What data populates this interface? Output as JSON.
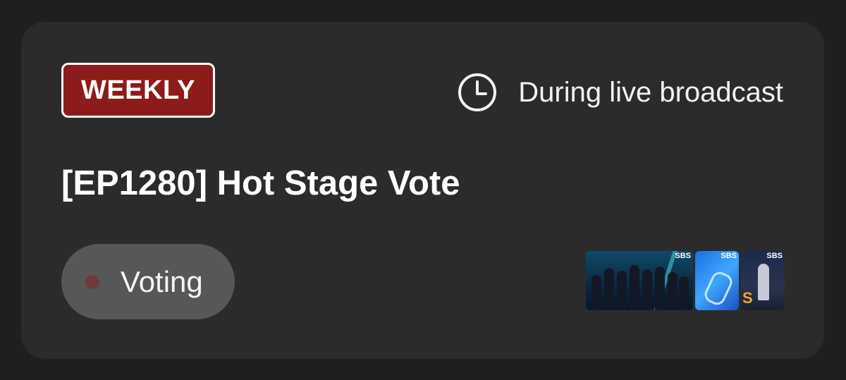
{
  "card": {
    "badge": "WEEKLY",
    "schedule": {
      "icon": "clock-icon",
      "text": "During live broadcast"
    },
    "title": "[EP1280] Hot Stage Vote",
    "status": {
      "label": "Voting",
      "dot_color": "#6e3a3a"
    },
    "thumbnails": [
      {
        "watermark": "SBS"
      },
      {
        "watermark": "SBS"
      },
      {
        "watermark": "SBS"
      }
    ]
  },
  "colors": {
    "background": "#1f1f1f",
    "card": "#2b2b2b",
    "badge": "#8e1b1b",
    "pill": "#575757"
  }
}
